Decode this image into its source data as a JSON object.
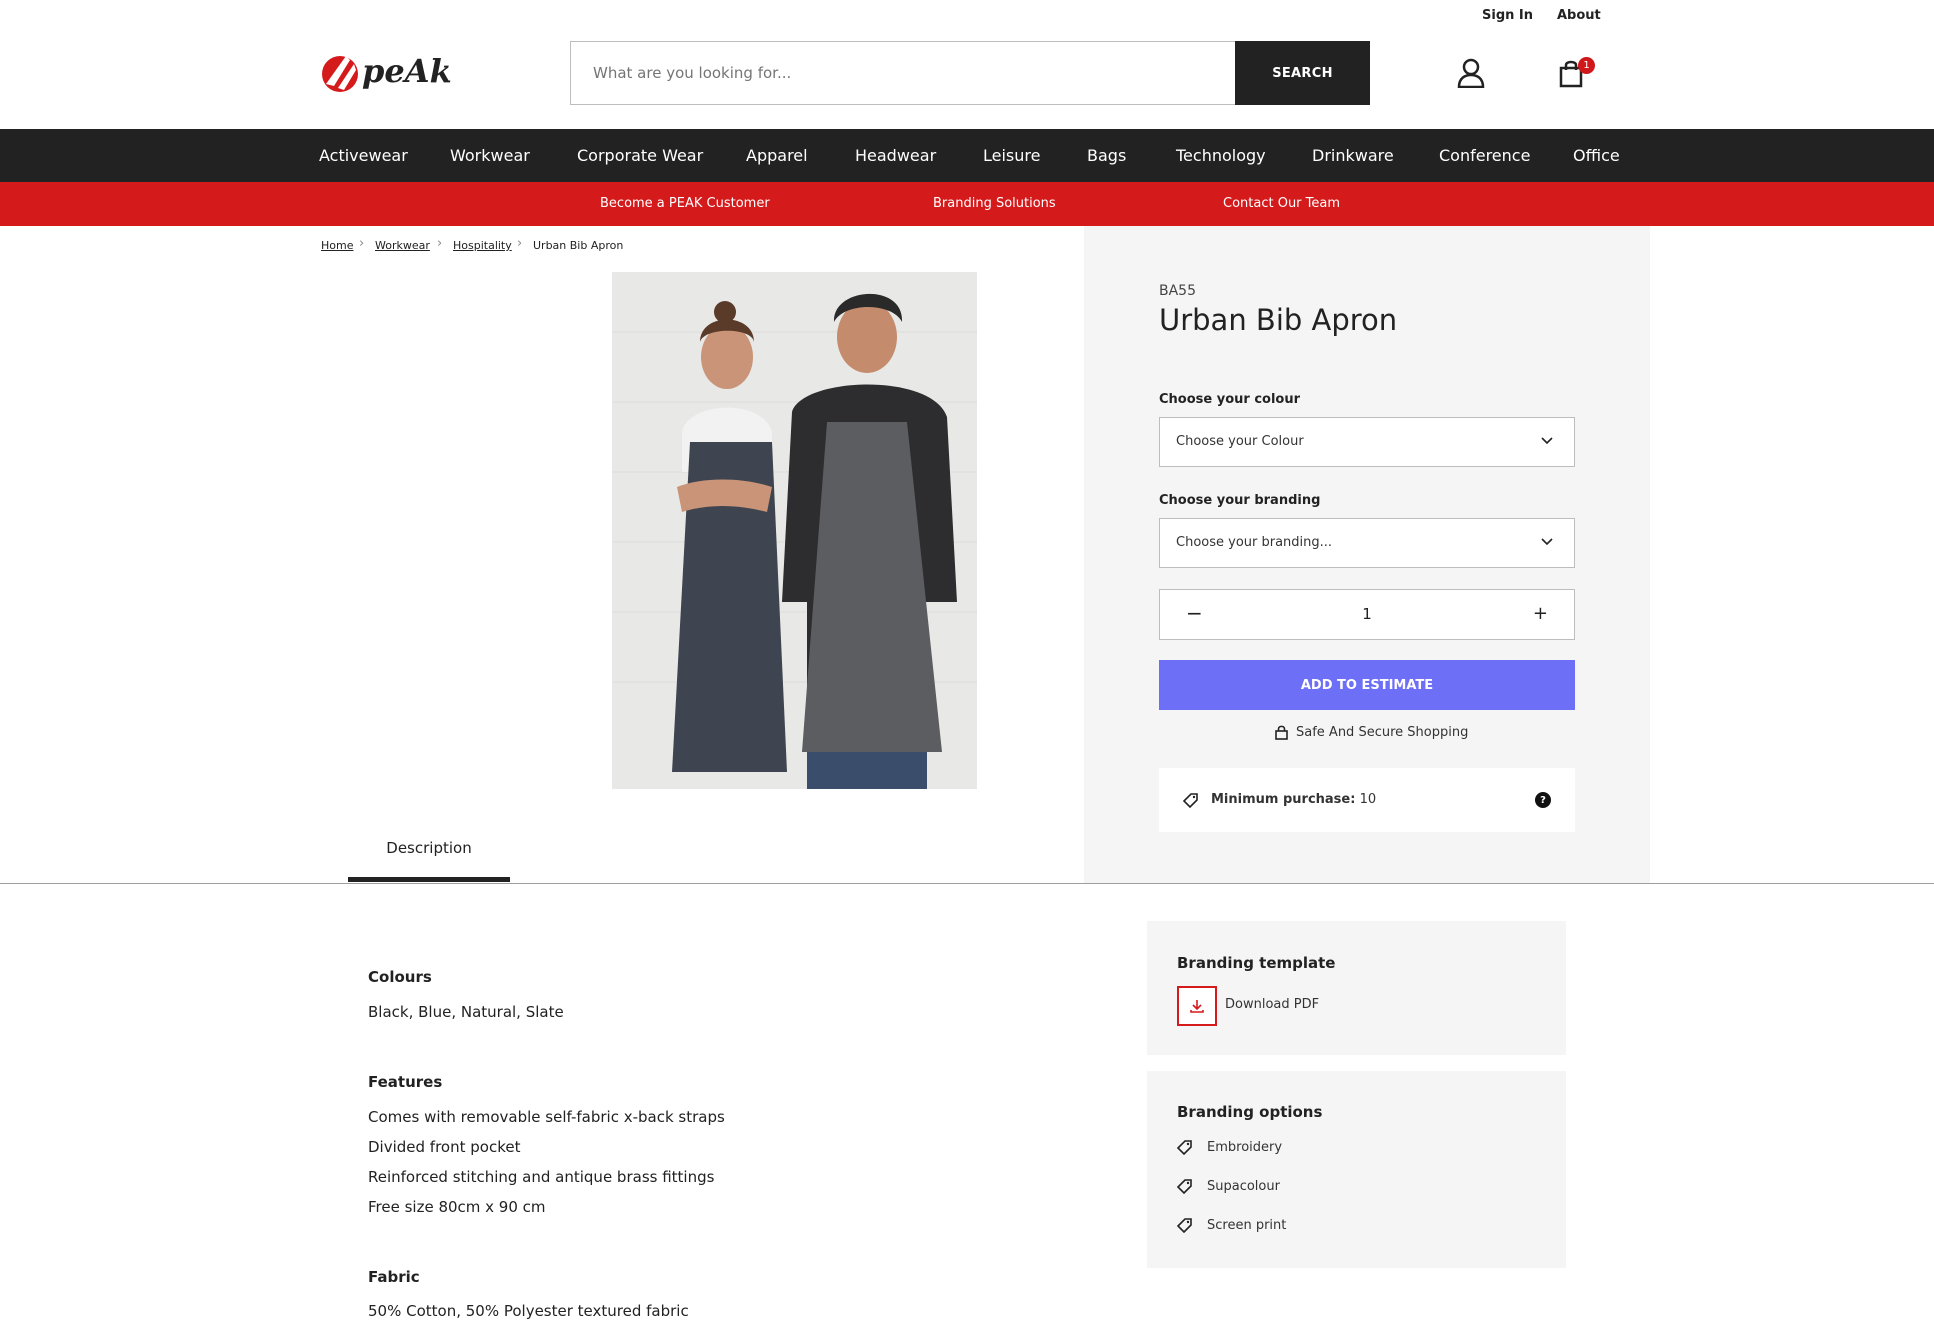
{
  "utility": {
    "sign_in": "Sign In",
    "about": "About"
  },
  "search": {
    "placeholder": "What are you looking for...",
    "button": "SEARCH"
  },
  "cart": {
    "count": "1"
  },
  "nav": [
    "Activewear",
    "Workwear",
    "Corporate Wear",
    "Apparel",
    "Headwear",
    "Leisure",
    "Bags",
    "Technology",
    "Drinkware",
    "Conference",
    "Office"
  ],
  "subnav": [
    "Become a PEAK Customer",
    "Branding Solutions",
    "Contact Our Team"
  ],
  "breadcrumb": [
    "Home",
    "Workwear",
    "Hospitality",
    "Urban Bib Apron"
  ],
  "product": {
    "sku": "BA55",
    "title": "Urban Bib Apron",
    "colour_label": "Choose your colour",
    "colour_value": "Choose your Colour",
    "branding_label": "Choose your branding",
    "branding_value": "Choose your branding...",
    "quantity": "1",
    "qty_minus": "−",
    "qty_plus": "+",
    "add_button": "ADD TO ESTIMATE",
    "secure_text": "Safe And Secure Shopping",
    "min_purchase_label": "Minimum purchase:",
    "min_purchase_value": "10"
  },
  "tabs": {
    "description": "Description"
  },
  "description": {
    "colours_heading": "Colours",
    "colours": "Black, Blue, Natural, Slate",
    "features_heading": "Features",
    "features": [
      "Comes with removable self-fabric x-back straps",
      "Divided front pocket",
      "Reinforced stitching and antique brass fittings",
      "Free size 80cm x 90 cm"
    ],
    "fabric_heading": "Fabric",
    "fabric": "50% Cotton, 50% Polyester textured fabric"
  },
  "branding_template": {
    "title": "Branding template",
    "download": "Download PDF"
  },
  "branding_options": {
    "title": "Branding options",
    "items": [
      "Embroidery",
      "Supacolour",
      "Screen print"
    ]
  },
  "colors": {
    "nav_bg": "#222222",
    "subnav_bg": "#d51a1c",
    "accent_button": "#6e6ff7",
    "panel_bg": "#f5f5f5",
    "badge": "#d0181a"
  }
}
